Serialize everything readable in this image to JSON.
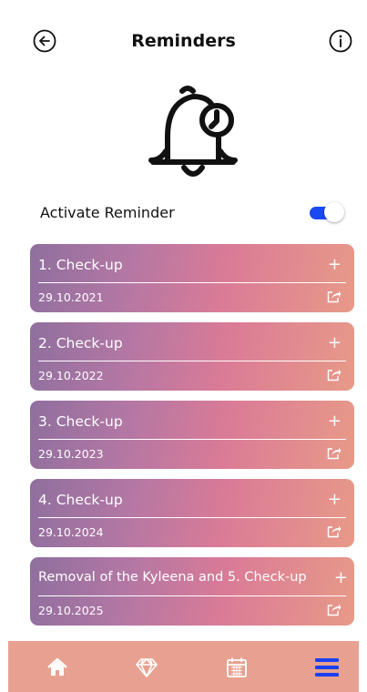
{
  "header": {
    "title": "Reminders",
    "back_icon": "arrow-left-circle-icon",
    "info_icon": "info-circle-icon"
  },
  "hero": {
    "icon": "bell-clock-icon"
  },
  "activate": {
    "label": "Activate Reminder",
    "enabled": true
  },
  "reminders": [
    {
      "title": "1. Check-up",
      "date": "29.10.2021"
    },
    {
      "title": "2. Check-up",
      "date": "29.10.2022"
    },
    {
      "title": "3. Check-up",
      "date": "29.10.2023"
    },
    {
      "title": "4. Check-up",
      "date": "29.10.2024"
    },
    {
      "title": "Removal of the Kyleena and 5. Check-up",
      "date": "29.10.2025"
    }
  ],
  "card": {
    "add_symbol": "+"
  },
  "nav": {
    "items": [
      {
        "icon": "home-icon"
      },
      {
        "icon": "diamond-icon"
      },
      {
        "icon": "calendar-icon"
      },
      {
        "icon": "menu-icon",
        "active": true
      }
    ]
  },
  "colors": {
    "accent": "#1a49f2",
    "card_gradient_start": "#8f6f9e",
    "card_gradient_end": "#e89a88",
    "nav_background": "#e8a190"
  }
}
